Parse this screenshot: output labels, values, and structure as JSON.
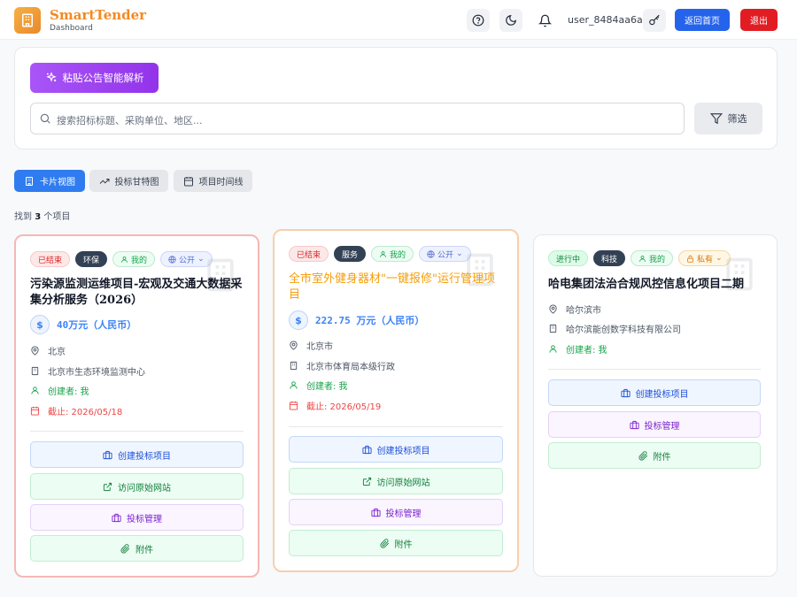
{
  "header": {
    "brand": "SmartTender",
    "subtitle": "Dashboard",
    "username": "user_8484aa6a",
    "home_label": "返回首页",
    "logout_label": "退出",
    "icons": [
      "help-circle-icon",
      "moon-icon",
      "bell-icon",
      "key-icon"
    ]
  },
  "toolbar": {
    "ai_parse_label": "粘贴公告智能解析",
    "search_placeholder": "搜索招标标题、采购单位、地区...",
    "filter_label": "筛选"
  },
  "views": [
    {
      "label": "卡片视图",
      "active": true
    },
    {
      "label": "投标甘特图",
      "active": false
    },
    {
      "label": "项目时间线",
      "active": false
    }
  ],
  "found": {
    "prefix": "找到",
    "count": "3",
    "suffix": "个项目"
  },
  "cards": [
    {
      "status": "已结束",
      "category": "环保",
      "owner_tag": "我的",
      "visibility": "公开",
      "title": "污染源监测运维项目-宏观及交通大数据采集分析服务（2026）",
      "budget": "40万元（人民币）",
      "region": "北京",
      "buyer": "北京市生态环境监测中心",
      "creator": "创建者: 我",
      "deadline": "截止: 2026/05/18",
      "actions": [
        "创建投标项目",
        "访问原始网站",
        "投标管理",
        "附件"
      ]
    },
    {
      "status": "已结束",
      "category": "服务",
      "owner_tag": "我的",
      "visibility": "公开",
      "title": "全市室外健身器材\"一键报修\"运行管理项目",
      "budget": "222.75 万元（人民币）",
      "region": "北京市",
      "buyer": "北京市体育局本级行政",
      "creator": "创建者: 我",
      "deadline": "截止: 2026/05/19",
      "actions": [
        "创建投标项目",
        "访问原始网站",
        "投标管理",
        "附件"
      ]
    },
    {
      "status": "进行中",
      "category": "科技",
      "owner_tag": "我的",
      "visibility": "私有",
      "title": "哈电集团法治合规风控信息化项目二期",
      "region": "哈尔滨市",
      "buyer": "哈尔滨能创数字科技有限公司",
      "creator": "创建者: 我",
      "actions": [
        "创建投标项目",
        "投标管理",
        "附件"
      ]
    }
  ],
  "colors": {
    "primary": "#2563eb",
    "danger": "#e11d23",
    "brand": "#f08a24",
    "ai": "#9333ea"
  }
}
